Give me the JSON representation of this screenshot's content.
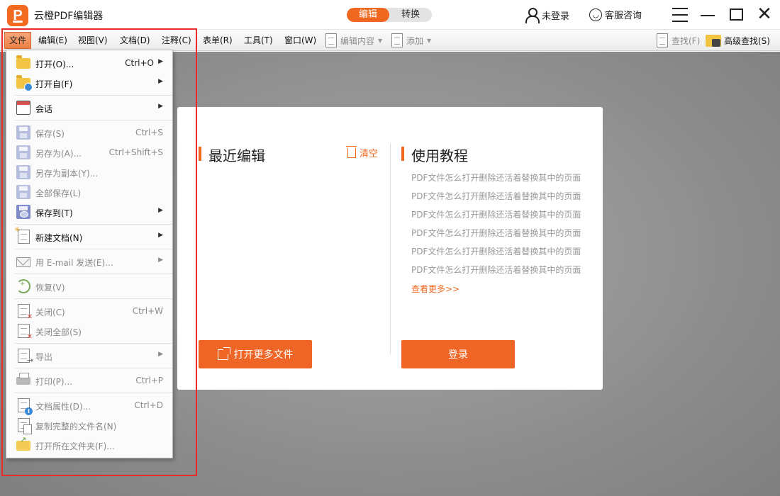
{
  "app": {
    "title": "云橙PDF编辑器",
    "logo_letter": "P",
    "modes": [
      "编辑",
      "转换"
    ],
    "active_mode": "编辑",
    "login_text": "未登录",
    "support_text": "客服咨询"
  },
  "menubar": {
    "items": [
      "文件",
      "编辑(E)",
      "视图(V)",
      "文档(D)",
      "注释(C)",
      "表单(R)",
      "工具(T)",
      "窗口(W)"
    ],
    "tools": {
      "edit_content": "编辑内容",
      "add": "添加",
      "find": "查找(F)",
      "advanced_find": "高级查找(S)"
    }
  },
  "file_menu": {
    "items": [
      {
        "label": "打开(O)...",
        "shortcut": "Ctrl+O",
        "submenu": true,
        "enabled": true,
        "icon": "folder-icon"
      },
      {
        "label": "打开自(F)",
        "shortcut": "",
        "submenu": true,
        "enabled": true,
        "icon": "folder-globe-icon"
      },
      {
        "label": "会话",
        "shortcut": "",
        "submenu": true,
        "enabled": true,
        "icon": "calendar-icon"
      },
      {
        "label": "保存(S)",
        "shortcut": "Ctrl+S",
        "submenu": false,
        "enabled": false,
        "icon": "save-icon"
      },
      {
        "label": "另存为(A)...",
        "shortcut": "Ctrl+Shift+S",
        "submenu": false,
        "enabled": false,
        "icon": "save-as-icon"
      },
      {
        "label": "另存为副本(Y)...",
        "shortcut": "",
        "submenu": false,
        "enabled": false,
        "icon": "save-copy-icon"
      },
      {
        "label": "全部保存(L)",
        "shortcut": "",
        "submenu": false,
        "enabled": false,
        "icon": "save-all-icon"
      },
      {
        "label": "保存到(T)",
        "shortcut": "",
        "submenu": true,
        "enabled": true,
        "icon": "save-to-icon"
      },
      {
        "label": "新建文档(N)",
        "shortcut": "",
        "submenu": true,
        "enabled": true,
        "icon": "new-document-icon"
      },
      {
        "label": "用 E-mail 发送(E)...",
        "shortcut": "",
        "submenu": true,
        "enabled": false,
        "icon": "email-icon"
      },
      {
        "label": "恢复(V)",
        "shortcut": "",
        "submenu": false,
        "enabled": false,
        "icon": "restore-icon"
      },
      {
        "label": "关闭(C)",
        "shortcut": "Ctrl+W",
        "submenu": false,
        "enabled": false,
        "icon": "close-document-icon"
      },
      {
        "label": "关闭全部(S)",
        "shortcut": "",
        "submenu": false,
        "enabled": false,
        "icon": "close-all-icon"
      },
      {
        "label": "导出",
        "shortcut": "",
        "submenu": true,
        "enabled": false,
        "icon": "export-icon"
      },
      {
        "label": "打印(P)...",
        "shortcut": "Ctrl+P",
        "submenu": false,
        "enabled": false,
        "icon": "printer-icon"
      },
      {
        "label": "文档属性(D)...",
        "shortcut": "Ctrl+D",
        "submenu": false,
        "enabled": false,
        "icon": "document-properties-icon"
      },
      {
        "label": "复制完整的文件名(N)",
        "shortcut": "",
        "submenu": false,
        "enabled": false,
        "icon": "copy-filename-icon"
      },
      {
        "label": "打开所在文件夹(F)...",
        "shortcut": "",
        "submenu": false,
        "enabled": false,
        "icon": "open-folder-icon"
      }
    ]
  },
  "start_page": {
    "recent_title": "最近编辑",
    "clear_label": "清空",
    "open_more_label": "打开更多文件",
    "tutorial_title": "使用教程",
    "tutorials": [
      "PDF文件怎么打开删除还活着替换其中的页面",
      "PDF文件怎么打开删除还活着替换其中的页面",
      "PDF文件怎么打开删除还活着替换其中的页面",
      "PDF文件怎么打开删除还活着替换其中的页面",
      "PDF文件怎么打开删除还活着替换其中的页面",
      "PDF文件怎么打开删除还活着替换其中的页面"
    ],
    "more_label": "查看更多>>",
    "login_button": "登录"
  },
  "colors": {
    "accent": "#f0671f",
    "highlight_border": "#e82b2b",
    "workspace_bg": "#8e8e8e"
  }
}
